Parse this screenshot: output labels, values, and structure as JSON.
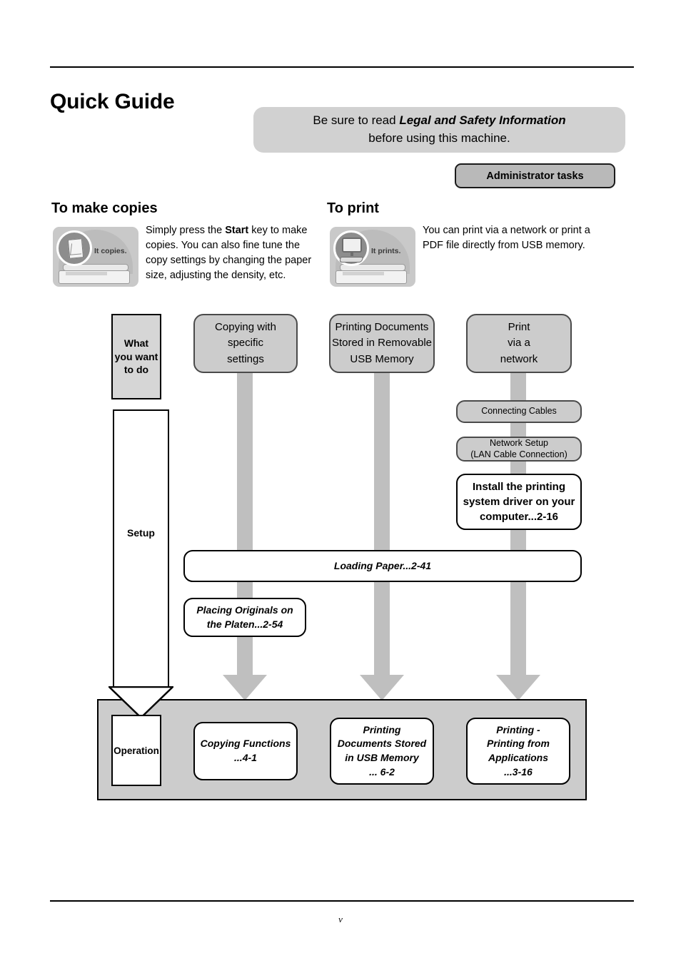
{
  "page": {
    "title": "Quick Guide",
    "folio": "v"
  },
  "notice": {
    "line1_before": "Be sure to read ",
    "line1_emphasis": "Legal and Safety Information",
    "line2": "before using this machine."
  },
  "admin_button": {
    "label": "Administrator tasks"
  },
  "sections": {
    "copies": {
      "heading": "To make copies",
      "illustration_caption": "It copies.",
      "body_before": "Simply press the ",
      "body_emphasis": "Start",
      "body_after": " key to make copies. You can also fine tune the copy settings by changing the paper size, adjusting the density, etc."
    },
    "print": {
      "heading": "To print",
      "illustration_caption": "It prints.",
      "body": "You can print via a network or print a PDF file directly from USB memory."
    }
  },
  "flow": {
    "lane_want": "What\nyou want\nto do",
    "lane_want_lines": [
      "What",
      "you want",
      "to do"
    ],
    "lane_setup": "Setup",
    "lane_operation": "Operation",
    "choices": [
      {
        "lines": [
          "Copying with",
          "specific",
          "settings"
        ]
      },
      {
        "lines": [
          "Printing Documents",
          "Stored in Removable",
          "USB Memory"
        ]
      },
      {
        "lines": [
          "Print",
          "via a",
          "network"
        ]
      }
    ],
    "network_steps": [
      {
        "lines": [
          "Connecting Cables"
        ]
      },
      {
        "lines": [
          "Network Setup",
          "(LAN Cable Connection)"
        ]
      }
    ],
    "install_driver": {
      "lines": [
        "Install the printing",
        "system driver on your",
        "computer...2-16"
      ]
    },
    "loading_paper": {
      "lines": [
        "Loading Paper...2-41"
      ]
    },
    "placing_originals": {
      "lines": [
        "Placing Originals on",
        "the Platen...2-54"
      ]
    },
    "operations": [
      {
        "lines": [
          "Copying Functions",
          "...4-1"
        ]
      },
      {
        "lines": [
          "Printing",
          "Documents Stored",
          "in USB Memory",
          "... 6-2"
        ]
      },
      {
        "lines": [
          "Printing -",
          "Printing from",
          "Applications",
          "...3-16"
        ]
      }
    ]
  },
  "colors": {
    "grey_fill": "#cccccc",
    "notice_fill": "#d1d1d1",
    "admin_fill": "#b9b9b9",
    "arrow_grey": "#bfbfbf",
    "ink": "#000000"
  }
}
